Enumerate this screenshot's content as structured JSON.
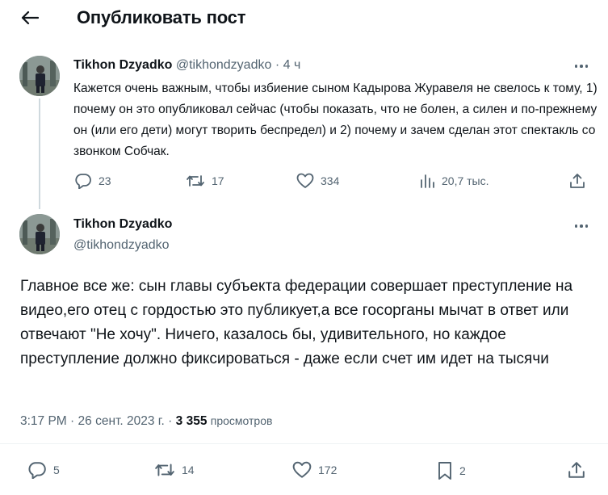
{
  "header": {
    "title": "Опубликовать пост"
  },
  "quoted_tweet": {
    "author_name": "Tikhon Dzyadko",
    "handle": "@tikhondzyadko",
    "separator": "·",
    "time": "4 ч",
    "text": "Кажется очень важным, чтобы избиение сыном Кадырова Журавеля не свелось к тому, 1) почему он это опубликовал сейчас (чтобы показать, что не болен, а силен и по-прежнему он (или его дети) могут творить беспредел) и 2) почему и зачем сделан этот спектакль со звонком Собчак.",
    "replies": "23",
    "reposts": "17",
    "likes": "334",
    "views": "20,7 тыс."
  },
  "main_tweet": {
    "author_name": "Tikhon Dzyadko",
    "handle": "@tikhondzyadko",
    "text": "Главное все же: сын главы субъекта федерации совершает преступление на видео,его отец с гордостью это публикует,а все госорганы мычат в ответ или отвечают \"Не хочу\". Ничего, казалось бы, удивительного, но каждое преступление должно фиксироваться - даже если счет им идет на тысячи",
    "time": "3:17 PM",
    "separator": "·",
    "date": "26 сент. 2023 г.",
    "views_count": "3 355",
    "views_label": "просмотров",
    "replies": "5",
    "reposts": "14",
    "likes": "172",
    "bookmarks": "2"
  },
  "icons": {
    "back": "arrow-left-icon",
    "more": "more-dots-icon",
    "reply": "reply-icon",
    "repost": "repost-icon",
    "like": "heart-icon",
    "views": "analytics-icon",
    "bookmark": "bookmark-icon",
    "share": "share-icon"
  },
  "colors": {
    "text": "#0f1419",
    "muted": "#536471",
    "thread_line": "#cfd9de",
    "background": "#ffffff"
  }
}
